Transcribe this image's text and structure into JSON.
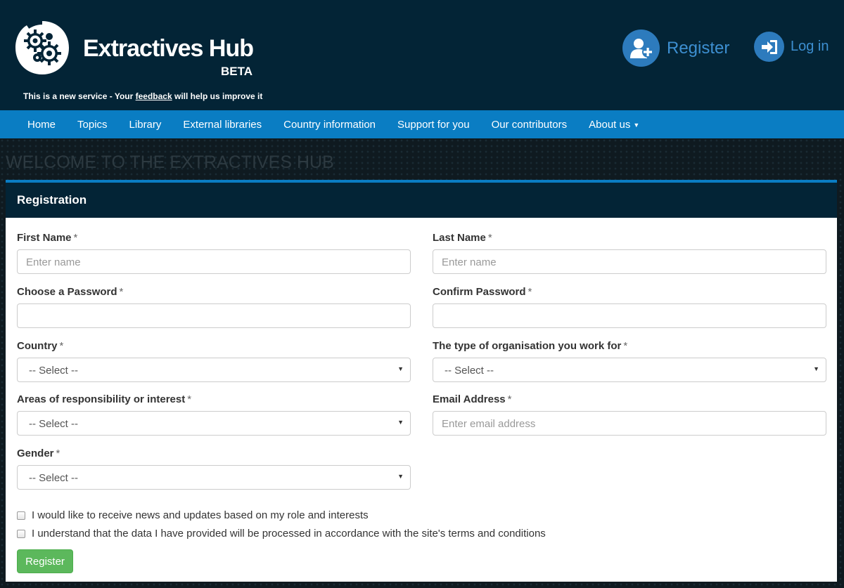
{
  "header": {
    "brand_title": "Extractives Hub",
    "brand_badge": "BETA",
    "beta_notice_prefix": "This is a new service - Your ",
    "beta_notice_link": "feedback",
    "beta_notice_suffix": " will help us improve it",
    "register_label": "Register",
    "login_label": "Log in"
  },
  "nav": {
    "items": [
      "Home",
      "Topics",
      "Library",
      "External libraries",
      "Country information",
      "Support for you",
      "Our contributors",
      "About us"
    ]
  },
  "hero": {
    "welcome": "WELCOME TO THE EXTRACTIVES HUB"
  },
  "form": {
    "title": "Registration",
    "required_mark": "*",
    "first_name": {
      "label": "First Name",
      "placeholder": "Enter name"
    },
    "last_name": {
      "label": "Last Name",
      "placeholder": "Enter name"
    },
    "password": {
      "label": "Choose a Password",
      "value": ""
    },
    "confirm_password": {
      "label": "Confirm Password",
      "value": ""
    },
    "country": {
      "label": "Country",
      "selected": "-- Select --"
    },
    "org_type": {
      "label": "The type of organisation you work for",
      "selected": "-- Select --"
    },
    "areas": {
      "label": "Areas of responsibility or interest",
      "selected": "-- Select --"
    },
    "email": {
      "label": "Email Address",
      "placeholder": "Enter email address"
    },
    "gender": {
      "label": "Gender",
      "selected": "-- Select --"
    },
    "checkbox_news": {
      "label": "I would like to receive news and updates based on my role and interests",
      "checked": false
    },
    "checkbox_terms": {
      "label": "I understand that the data I have provided will be processed in accordance with the site's terms and conditions",
      "checked": false
    },
    "submit_label": "Register"
  },
  "colors": {
    "header_bg": "#032436",
    "nav_bg": "#0a7dc3",
    "accent_blue": "#2d7bbd",
    "submit_green": "#5cb85c"
  },
  "icons": {
    "logo": "gears-logo-icon",
    "register": "add-user-icon",
    "login": "sign-in-icon",
    "dropdown": "caret-down-icon"
  }
}
